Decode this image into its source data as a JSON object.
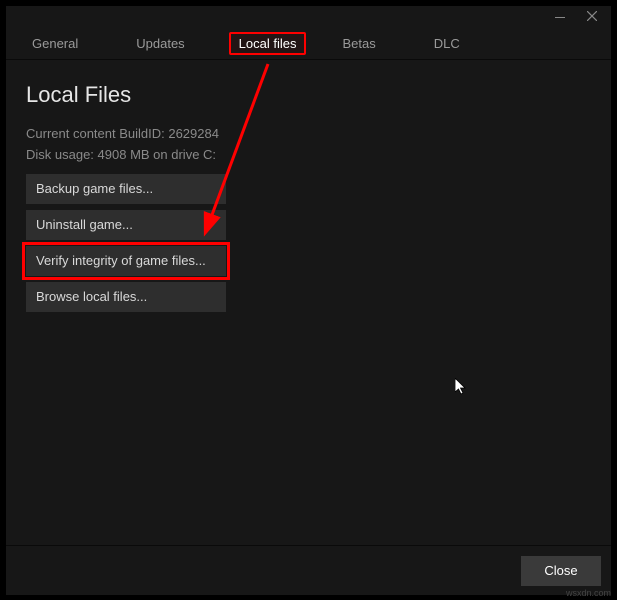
{
  "titlebar": {
    "minimize": "minimize",
    "close": "close"
  },
  "tabs": {
    "general": "General",
    "updates": "Updates",
    "local_files": "Local files",
    "betas": "Betas",
    "dlc": "DLC"
  },
  "page": {
    "title": "Local Files",
    "build_info": "Current content BuildID: 2629284",
    "disk_info": "Disk usage: 4908 MB on drive C:"
  },
  "actions": {
    "backup": "Backup game files...",
    "uninstall": "Uninstall game...",
    "verify": "Verify integrity of game files...",
    "browse": "Browse local files..."
  },
  "footer": {
    "close": "Close"
  },
  "watermark": "wsxdn.com"
}
